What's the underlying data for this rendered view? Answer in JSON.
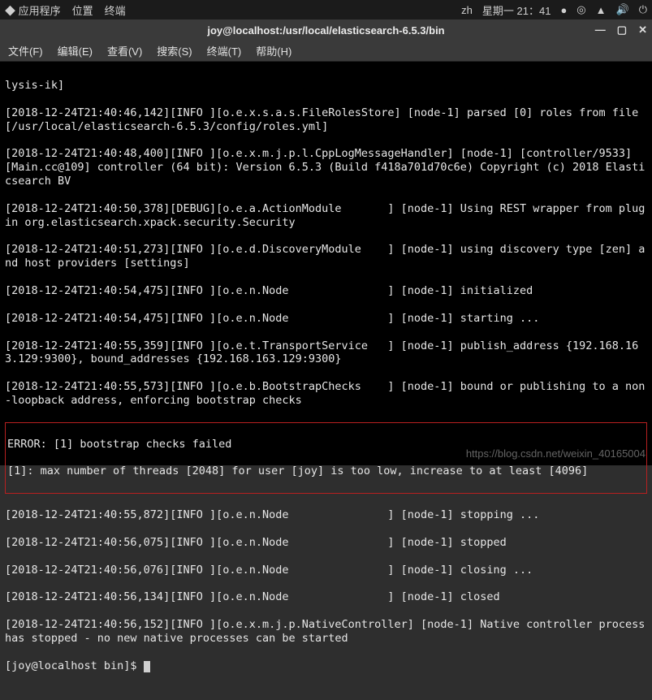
{
  "panel": {
    "apps": "应用程序",
    "places": "位置",
    "terminal": "终端",
    "lang": "zh",
    "clock": "星期一 21：41"
  },
  "window": {
    "title": "joy@localhost:/usr/local/elasticsearch-6.5.3/bin"
  },
  "menu": {
    "file": "文件(F)",
    "edit": "编辑(E)",
    "view": "查看(V)",
    "search": "搜索(S)",
    "terminal": "终端(T)",
    "help": "帮助(H)"
  },
  "lines": {
    "l0": "lysis-ik]",
    "l1": "[2018-12-24T21:40:46,142][INFO ][o.e.x.s.a.s.FileRolesStore] [node-1] parsed [0] roles from file [/usr/local/elasticsearch-6.5.3/config/roles.yml]",
    "l2": "[2018-12-24T21:40:48,400][INFO ][o.e.x.m.j.p.l.CppLogMessageHandler] [node-1] [controller/9533] [Main.cc@109] controller (64 bit): Version 6.5.3 (Build f418a701d70c6e) Copyright (c) 2018 Elasticsearch BV",
    "l3": "[2018-12-24T21:40:50,378][DEBUG][o.e.a.ActionModule       ] [node-1] Using REST wrapper from plugin org.elasticsearch.xpack.security.Security",
    "l4": "[2018-12-24T21:40:51,273][INFO ][o.e.d.DiscoveryModule    ] [node-1] using discovery type [zen] and host providers [settings]",
    "l5": "[2018-12-24T21:40:54,475][INFO ][o.e.n.Node               ] [node-1] initialized",
    "l6": "[2018-12-24T21:40:54,475][INFO ][o.e.n.Node               ] [node-1] starting ...",
    "l7": "[2018-12-24T21:40:55,359][INFO ][o.e.t.TransportService   ] [node-1] publish_address {192.168.163.129:9300}, bound_addresses {192.168.163.129:9300}",
    "l8": "[2018-12-24T21:40:55,573][INFO ][o.e.b.BootstrapChecks    ] [node-1] bound or publishing to a non-loopback address, enforcing bootstrap checks",
    "err1": "ERROR: [1] bootstrap checks failed",
    "err2": "[1]: max number of threads [2048] for user [joy] is too low, increase to at least [4096]",
    "l9": "[2018-12-24T21:40:55,872][INFO ][o.e.n.Node               ] [node-1] stopping ...",
    "l10": "[2018-12-24T21:40:56,075][INFO ][o.e.n.Node               ] [node-1] stopped",
    "l11": "[2018-12-24T21:40:56,076][INFO ][o.e.n.Node               ] [node-1] closing ...",
    "l12": "[2018-12-24T21:40:56,134][INFO ][o.e.n.Node               ] [node-1] closed",
    "l13": "[2018-12-24T21:40:56,152][INFO ][o.e.x.m.j.p.NativeController] [node-1] Native controller process has stopped - no new native processes can be started",
    "prompt": "[joy@localhost bin]$ "
  },
  "watermark": "https://blog.csdn.net/weixin_40165004"
}
